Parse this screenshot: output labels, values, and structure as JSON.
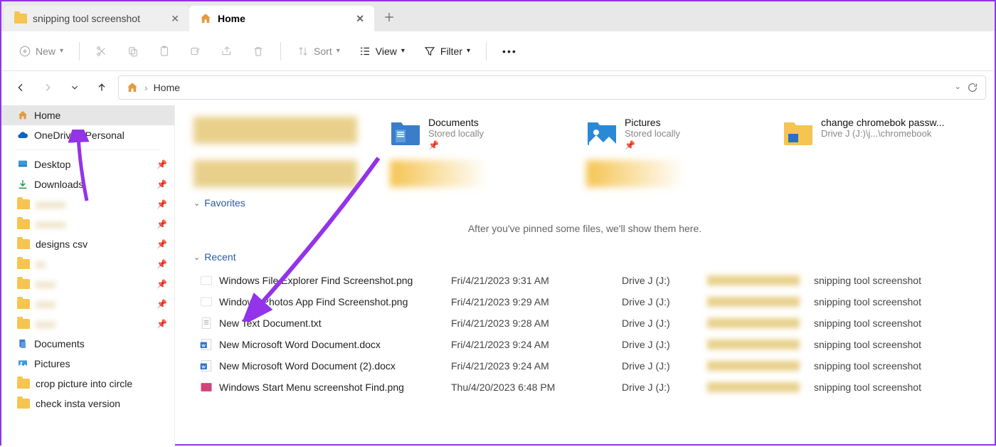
{
  "tabs": {
    "items": [
      {
        "label": "snipping tool screenshot",
        "icon": "folder",
        "active": false
      },
      {
        "label": "Home",
        "icon": "home",
        "active": true
      }
    ]
  },
  "toolbar": {
    "new": "New",
    "sort": "Sort",
    "view": "View",
    "filter": "Filter"
  },
  "address": {
    "path": "Home"
  },
  "sidebar": {
    "home": "Home",
    "onedrive": "OneDrive - Personal",
    "desktop": "Desktop",
    "downloads": "Downloads",
    "designs": "designs csv",
    "documents": "Documents",
    "pictures": "Pictures",
    "crop": "crop picture into circle",
    "check": "check insta version"
  },
  "quick": {
    "documents": {
      "title": "Documents",
      "sub": "Stored locally"
    },
    "pictures": {
      "title": "Pictures",
      "sub": "Stored locally"
    },
    "change": {
      "title": "change chromebok passw...",
      "sub": "Drive J (J:)\\j...\\chromebook"
    }
  },
  "sections": {
    "favorites": "Favorites",
    "favorites_msg": "After you've pinned some files, we'll show them here.",
    "recent": "Recent"
  },
  "recent": [
    {
      "name": "Windows File Explorer Find Screenshot.png",
      "date": "Fri/4/21/2023 9:31 AM",
      "drive": "Drive J (J:)",
      "tag": "snipping tool screenshot",
      "icon": "png"
    },
    {
      "name": "Windows Photos App Find Screenshot.png",
      "date": "Fri/4/21/2023 9:29 AM",
      "drive": "Drive J (J:)",
      "tag": "snipping tool screenshot",
      "icon": "png"
    },
    {
      "name": "New Text Document.txt",
      "date": "Fri/4/21/2023 9:28 AM",
      "drive": "Drive J (J:)",
      "tag": "snipping tool screenshot",
      "icon": "txt"
    },
    {
      "name": "New Microsoft Word Document.docx",
      "date": "Fri/4/21/2023 9:24 AM",
      "drive": "Drive J (J:)",
      "tag": "snipping tool screenshot",
      "icon": "docx"
    },
    {
      "name": "New Microsoft Word Document (2).docx",
      "date": "Fri/4/21/2023 9:24 AM",
      "drive": "Drive J (J:)",
      "tag": "snipping tool screenshot",
      "icon": "docx"
    },
    {
      "name": "Windows Start Menu screenshot Find.png",
      "date": "Thu/4/20/2023 6:48 PM",
      "drive": "Drive J (J:)",
      "tag": "snipping tool screenshot",
      "icon": "img"
    }
  ]
}
